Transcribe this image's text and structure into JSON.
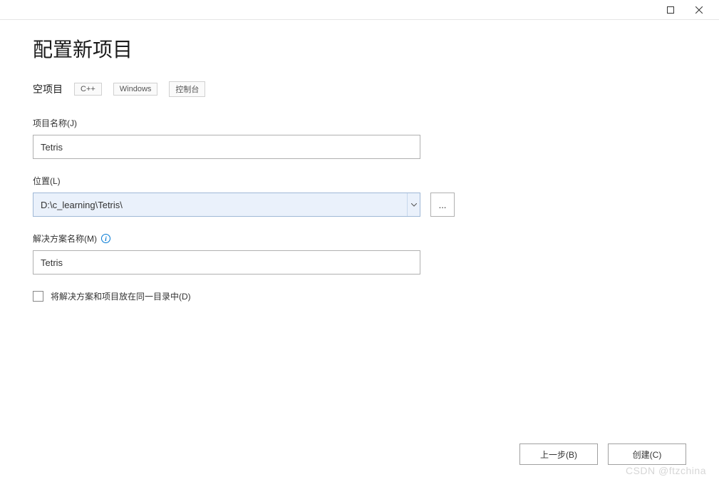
{
  "titlebar": {
    "maximize_icon": "maximize-icon",
    "close_icon": "close-icon"
  },
  "page": {
    "title": "配置新项目"
  },
  "template": {
    "name": "空项目",
    "tags": [
      "C++",
      "Windows",
      "控制台"
    ]
  },
  "fields": {
    "project_name": {
      "label": "项目名称(J)",
      "value": "Tetris"
    },
    "location": {
      "label": "位置(L)",
      "value": "D:\\c_learning\\Tetris\\",
      "browse_label": "..."
    },
    "solution_name": {
      "label": "解决方案名称(M)",
      "value": "Tetris"
    },
    "same_dir": {
      "label": "将解决方案和项目放在同一目录中(D)",
      "checked": false
    }
  },
  "footer": {
    "back": "上一步(B)",
    "create": "创建(C)"
  },
  "watermark": "CSDN @ftzchina"
}
